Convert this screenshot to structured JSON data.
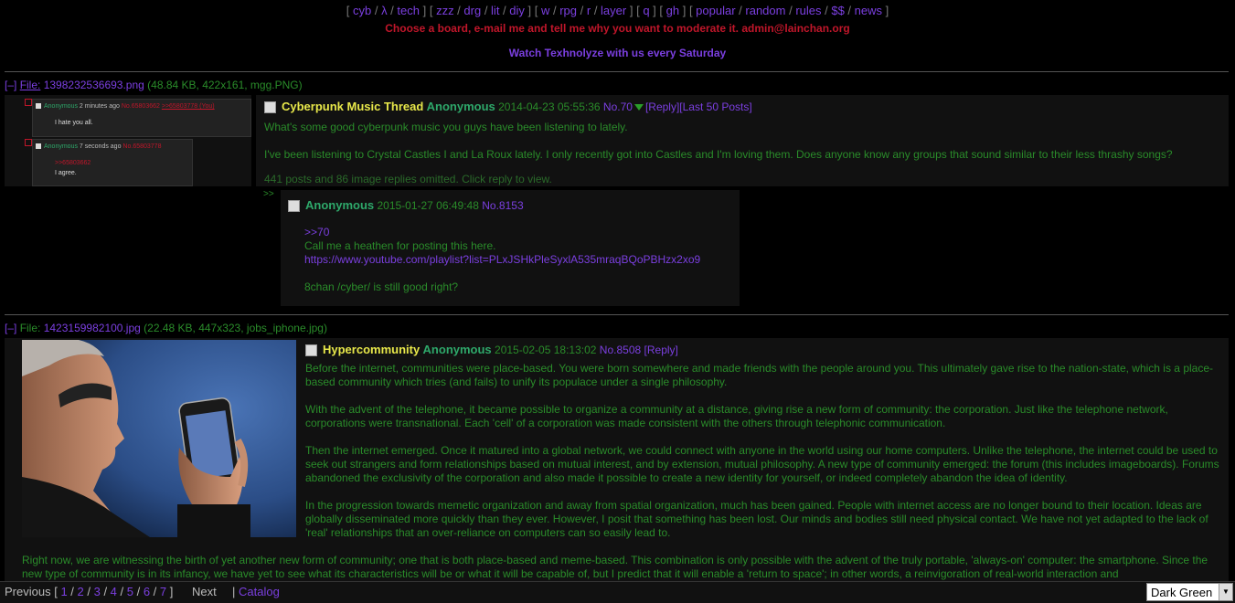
{
  "nav": {
    "groups": [
      [
        "cyb",
        "λ",
        "tech"
      ],
      [
        "zzz",
        "drg",
        "lit",
        "diy"
      ],
      [
        "w",
        "rpg",
        "r",
        "layer"
      ],
      [
        "q"
      ],
      [
        "gh"
      ],
      [
        "popular",
        "random",
        "rules",
        "$$",
        "news"
      ]
    ]
  },
  "announcements": {
    "line1": "Choose a board, e-mail me and tell me why you want to moderate it. admin@lainchan.org",
    "line2": "Watch Texhnolyze with us every Saturday"
  },
  "thread1": {
    "toggle": "[–]",
    "file_label": "File:",
    "file_name": "1398232536693.png",
    "file_info": "(48.84 KB, 422x161, mgg.PNG)",
    "thumb": {
      "post1": {
        "name": "Anonymous",
        "time": "2 minutes ago",
        "no": "No.65803662",
        "ref": ">>65803778 (You)",
        "text": "I hate you all."
      },
      "post2": {
        "name": "Anonymous",
        "time": "7 seconds ago",
        "no": "No.65803778",
        "ref": ">>65803662",
        "text": "I agree."
      }
    },
    "subject": "Cyberpunk Music Thread",
    "name": "Anonymous",
    "date": "2014-04-23 05:55:36",
    "no": "No.70",
    "reply_link": "[Reply]",
    "last50_link": "[Last 50 Posts]",
    "body1": "What's some good cyberpunk music you guys have been listening to lately.",
    "body2": "I've been listening to Crystal Castles I and La Roux lately. I only recently got into Castles and I'm loving them. Does anyone know any groups that sound similar to their less thrashy songs?",
    "omitted": "441 posts and 86 image replies omitted. Click reply to view.",
    "reply": {
      "arrows": ">>",
      "name": "Anonymous",
      "date": "2015-01-27 06:49:48",
      "no": "No.8153",
      "quote": ">>70",
      "line1": "Call me a heathen for posting this here.",
      "link": "https://www.youtube.com/playlist?list=PLxJSHkPleSyxlA535mraqBQoPBHzx2xo9",
      "line2": "8chan /cyber/ is still good right?"
    }
  },
  "thread2": {
    "toggle": "[–]",
    "file_label": "File:",
    "file_name": "1423159982100.jpg",
    "file_info": "(22.48 KB, 447x323, jobs_iphone.jpg)",
    "subject": "Hypercommunity",
    "name": "Anonymous",
    "date": "2015-02-05 18:13:02",
    "no": "No.8508",
    "reply_link": "[Reply]",
    "p1": "Before the internet, communities were place-based. You were born somewhere and made friends with the people around you. This ultimately gave rise to the nation-state, which is a place-based community which tries (and fails) to unify its populace under a single philosophy.",
    "p2": "With the advent of the telephone, it became possible to organize a community at a distance, giving rise a new form of community: the corporation. Just like the telephone network, corporations were transnational. Each 'cell' of a corporation was made consistent with the others through telephonic communication.",
    "p3": "Then the internet emerged. Once it matured into a global network, we could connect with anyone in the world using our home computers. Unlike the telephone, the internet could be used to seek out strangers and form relationships based on mutual interest, and by extension, mutual philosophy. A new type of community emerged: the forum (this includes imageboards). Forums abandoned the exclusivity of the corporation and also made it possible to create a new identity for yourself, or indeed completely abandon the idea of identity.",
    "p4": "In the progression towards memetic organization and away from spatial organization, much has been gained. People with internet access are no longer bound to their location. Ideas are globally disseminated more quickly than they ever. However, I posit that something has been lost. Our minds and bodies still need physical contact. We have not yet adapted to the lack of 'real' relationships that an over-reliance on computers can so easily lead to.",
    "p5": "Right now, we are witnessing the birth of yet another new form of community; one that is both place-based and meme-based. This combination is only possible with the advent of the truly portable, 'always-on' computer: the smartphone. Since the new type of community is in its infancy, we have yet to see what its characteristics will be or what it will be capable of, but I predict that it will enable a 'return to space'; in other words, a reinvigoration of real-world interaction and"
  },
  "footer": {
    "previous": "Previous",
    "pages": [
      "1",
      "2",
      "3",
      "4",
      "5",
      "6",
      "7"
    ],
    "next": "Next",
    "catalog": "Catalog",
    "style_select": "Dark Green"
  }
}
